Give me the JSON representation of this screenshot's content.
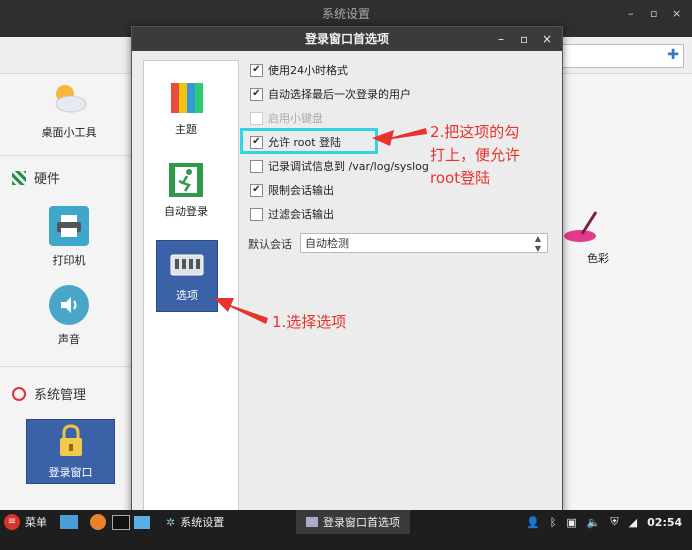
{
  "background_window": {
    "title": "系统设置",
    "sections": {
      "desktop_widgets_label": "桌面小工具",
      "hardware_label": "硬件",
      "printer_label": "打印机",
      "sound_label": "声音",
      "color_label": "色彩",
      "system_admin_label": "系统管理",
      "login_window_label": "登录窗口"
    }
  },
  "dialog": {
    "title": "登录窗口首选项",
    "controls": {
      "minimize": "–",
      "maximize": "▫",
      "close": "×"
    },
    "sidebar": [
      {
        "label": "主题",
        "icon": "color-palette-icon"
      },
      {
        "label": "自动登录",
        "icon": "auto-login-exit-icon"
      },
      {
        "label": "选项",
        "icon": "options-keyboard-icon",
        "active": true
      }
    ],
    "options": [
      {
        "label": "使用24小时格式",
        "checked": true,
        "enabled": true
      },
      {
        "label": "自动选择最后一次登录的用户",
        "checked": true,
        "enabled": true
      },
      {
        "label": "启用小键盘",
        "checked": false,
        "enabled": false
      },
      {
        "label": "允许 root 登陆",
        "checked": true,
        "enabled": true
      },
      {
        "label": "记录调试信息到 /var/log/syslog",
        "checked": false,
        "enabled": true
      },
      {
        "label": "限制会话输出",
        "checked": true,
        "enabled": true
      },
      {
        "label": "过滤会话输出",
        "checked": false,
        "enabled": true
      }
    ],
    "default_session": {
      "label": "默认会话",
      "value": "自动检测"
    }
  },
  "annotations": {
    "step2_line1": "2.把这项的勾",
    "step2_line2": "打上，便允许",
    "step2_line3": "root登陆",
    "step1": "1.选择选项",
    "color": "#e8332c",
    "highlight_color": "#2fd6e0"
  },
  "taskbar": {
    "menu_label": "菜单",
    "settings_label": "系统设置",
    "active_window_label": "登录窗口首选项",
    "clock": "02:54"
  }
}
